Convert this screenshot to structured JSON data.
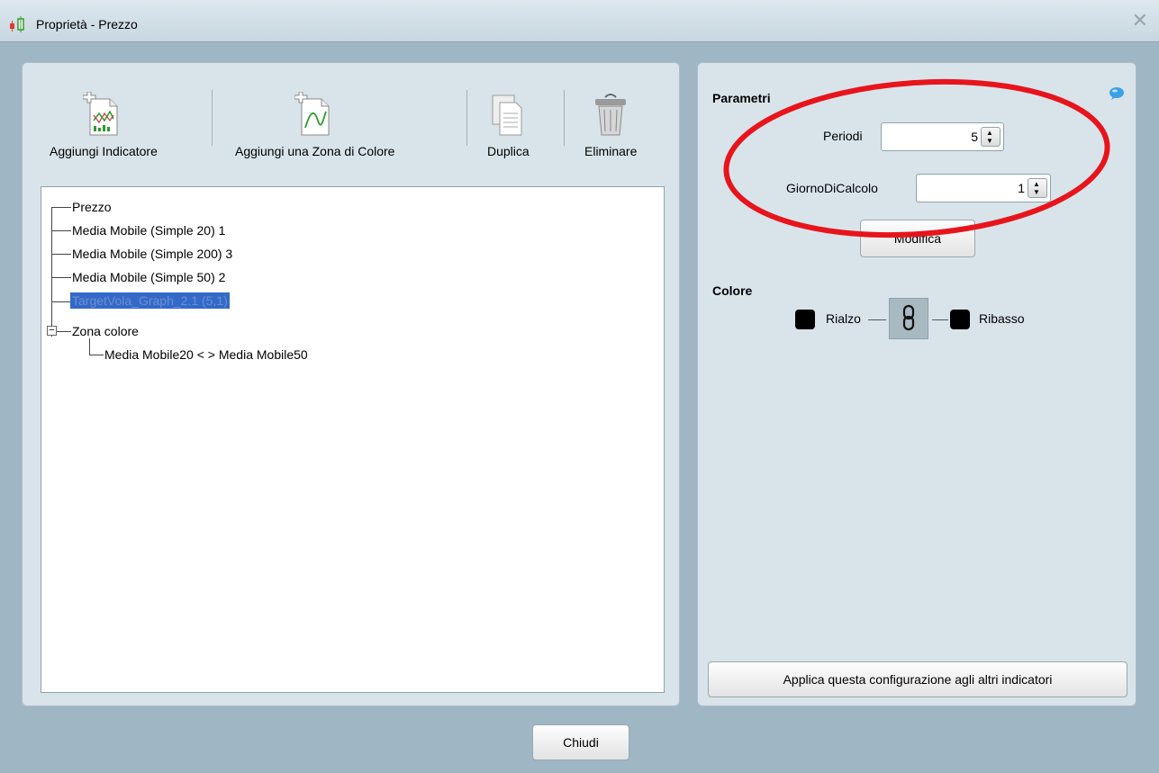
{
  "window": {
    "title": "Proprietà - Prezzo"
  },
  "toolbar": {
    "add_indicator": "Aggiungi Indicatore",
    "add_color_zone": "Aggiungi una Zona di Colore",
    "duplicate": "Duplica",
    "delete": "Eliminare"
  },
  "tree": {
    "items": [
      "Prezzo",
      "Media Mobile (Simple 20) 1",
      "Media Mobile (Simple 200) 3",
      "Media Mobile (Simple 50) 2",
      "TargetVola_Graph_2.1 (5,1)"
    ],
    "zone_group": "Zona colore",
    "expander": "−",
    "zone_child": "Media Mobile20 < > Media Mobile50"
  },
  "params": {
    "title": "Parametri",
    "periodi_label": "Periodi",
    "periodi_value": "5",
    "giorno_label": "GiornoDiCalcolo",
    "giorno_value": "1",
    "modify_button": "Modifica"
  },
  "color": {
    "title": "Colore",
    "up_label": "Rialzo",
    "down_label": "Ribasso",
    "up_color": "#000000",
    "down_color": "#000000"
  },
  "apply_button": "Applica questa configurazione agli altri indicatori",
  "close_button": "Chiudi"
}
